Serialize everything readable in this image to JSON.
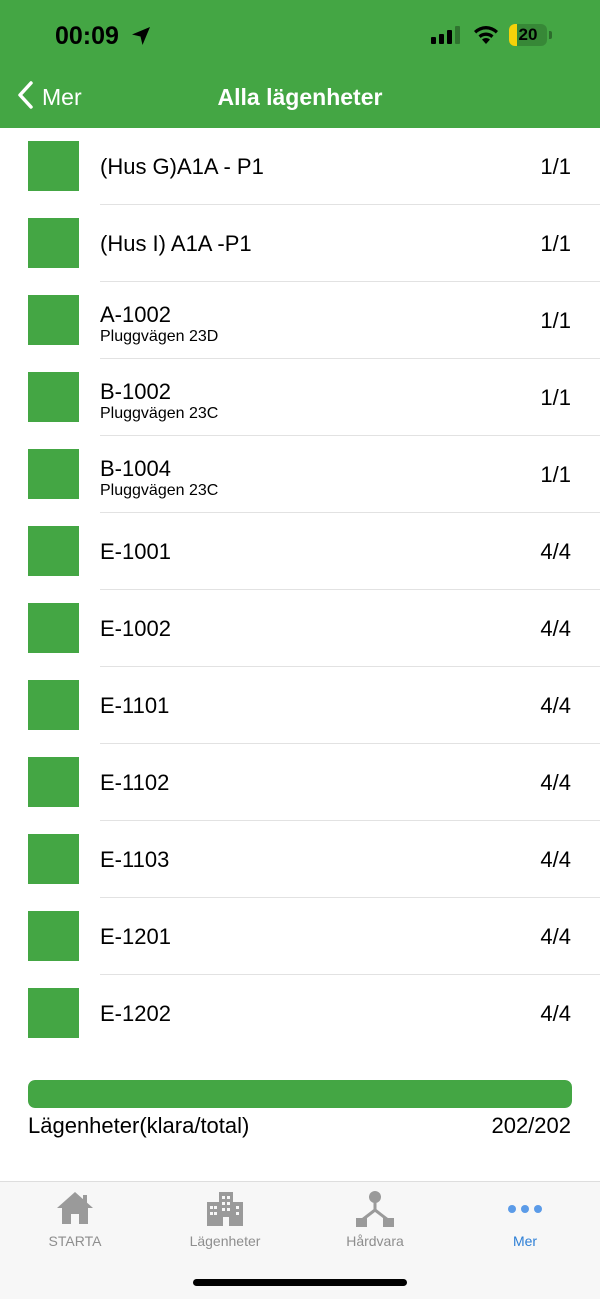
{
  "status_bar": {
    "time": "00:09",
    "battery": "20",
    "battery_level_percent": 20
  },
  "nav": {
    "back_label": "Mer",
    "title": "Alla lägenheter"
  },
  "rows": [
    {
      "title": "(Hus G)A1A - P1",
      "subtitle": "",
      "count": "1/1"
    },
    {
      "title": "(Hus I) A1A -P1",
      "subtitle": "",
      "count": "1/1"
    },
    {
      "title": "A-1002",
      "subtitle": "Pluggvägen 23D",
      "count": "1/1"
    },
    {
      "title": "B-1002",
      "subtitle": "Pluggvägen 23C",
      "count": "1/1"
    },
    {
      "title": "B-1004",
      "subtitle": "Pluggvägen 23C",
      "count": "1/1"
    },
    {
      "title": "E-1001",
      "subtitle": "",
      "count": "4/4"
    },
    {
      "title": "E-1002",
      "subtitle": "",
      "count": "4/4"
    },
    {
      "title": "E-1101",
      "subtitle": "",
      "count": "4/4"
    },
    {
      "title": "E-1102",
      "subtitle": "",
      "count": "4/4"
    },
    {
      "title": "E-1103",
      "subtitle": "",
      "count": "4/4"
    },
    {
      "title": "E-1201",
      "subtitle": "",
      "count": "4/4"
    },
    {
      "title": "E-1202",
      "subtitle": "",
      "count": "4/4"
    }
  ],
  "summary": {
    "label": "Lägenheter(klara/total)",
    "value": "202/202",
    "progress_fraction": 1.0
  },
  "tabs": [
    {
      "label": "STARTA",
      "icon": "home-icon",
      "active": false
    },
    {
      "label": "Lägenheter",
      "icon": "building-icon",
      "active": false
    },
    {
      "label": "Hårdvara",
      "icon": "network-icon",
      "active": false
    },
    {
      "label": "Mer",
      "icon": "more-icon",
      "active": true
    }
  ],
  "colors": {
    "brand_green": "#44a644",
    "active_tab": "#2d7fd6",
    "inactive_tab": "#8e8e8e"
  }
}
